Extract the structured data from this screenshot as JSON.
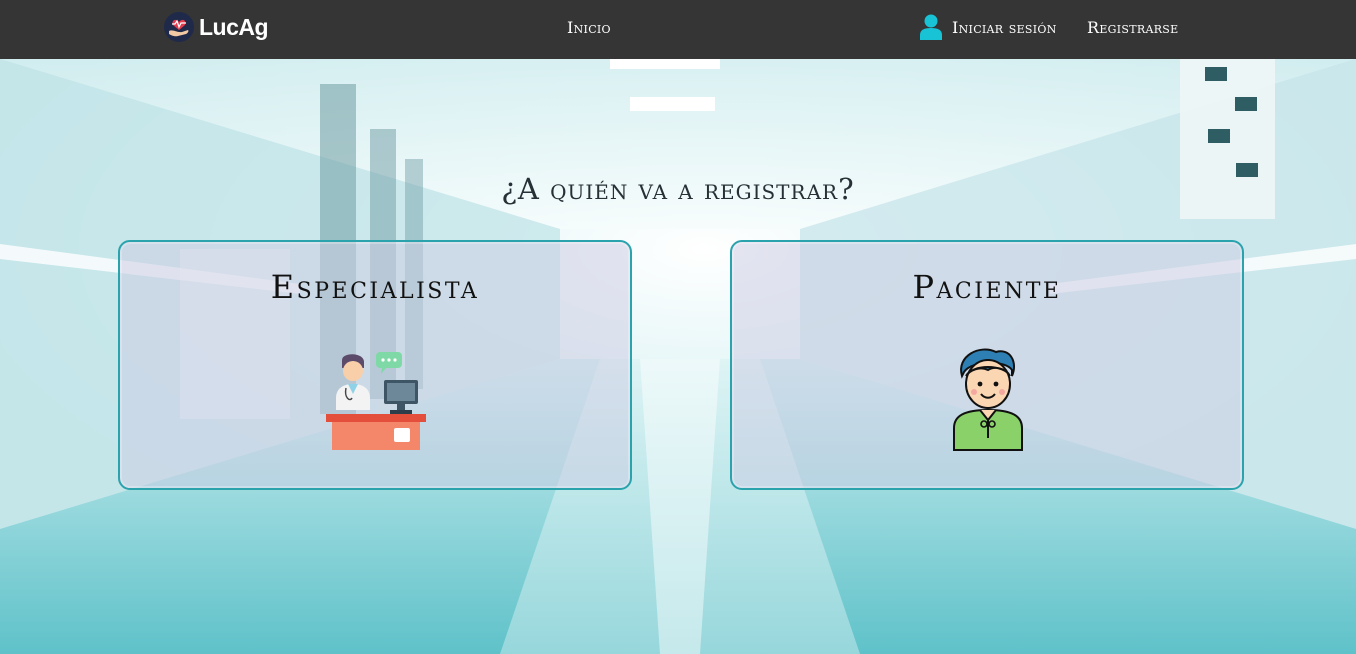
{
  "navbar": {
    "brand": "LucAg",
    "links": {
      "inicio": "Inicio",
      "login": "Iniciar sesión",
      "register": "Registrarse"
    }
  },
  "main": {
    "title": "¿A quién va a registrar?",
    "options": [
      {
        "label": "Especialista",
        "icon": "doctor-at-desk-icon"
      },
      {
        "label": "Paciente",
        "icon": "patient-icon"
      }
    ]
  },
  "colors": {
    "navbar_bg": "#353535",
    "card_border": "#2aa3ad",
    "accent_user_icon": "#19c3d6"
  }
}
